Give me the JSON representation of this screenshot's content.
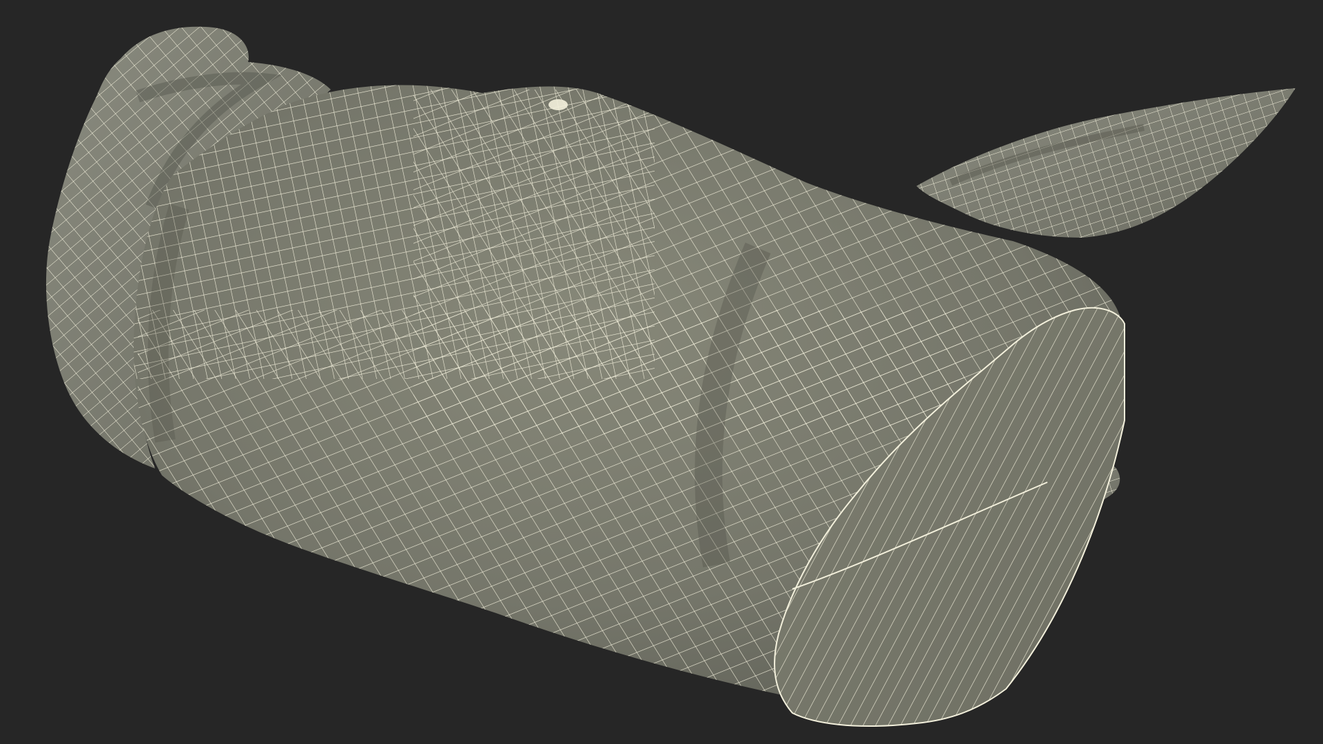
{
  "scene": {
    "subject": "wireframe-mesh-model",
    "colors": {
      "background": "#262626",
      "surface": "#7b7c70",
      "surface_light": "#8e8f84",
      "surface_shadow": "#5f6057",
      "cap": "#777869",
      "wire": "#f3f0dc"
    }
  }
}
